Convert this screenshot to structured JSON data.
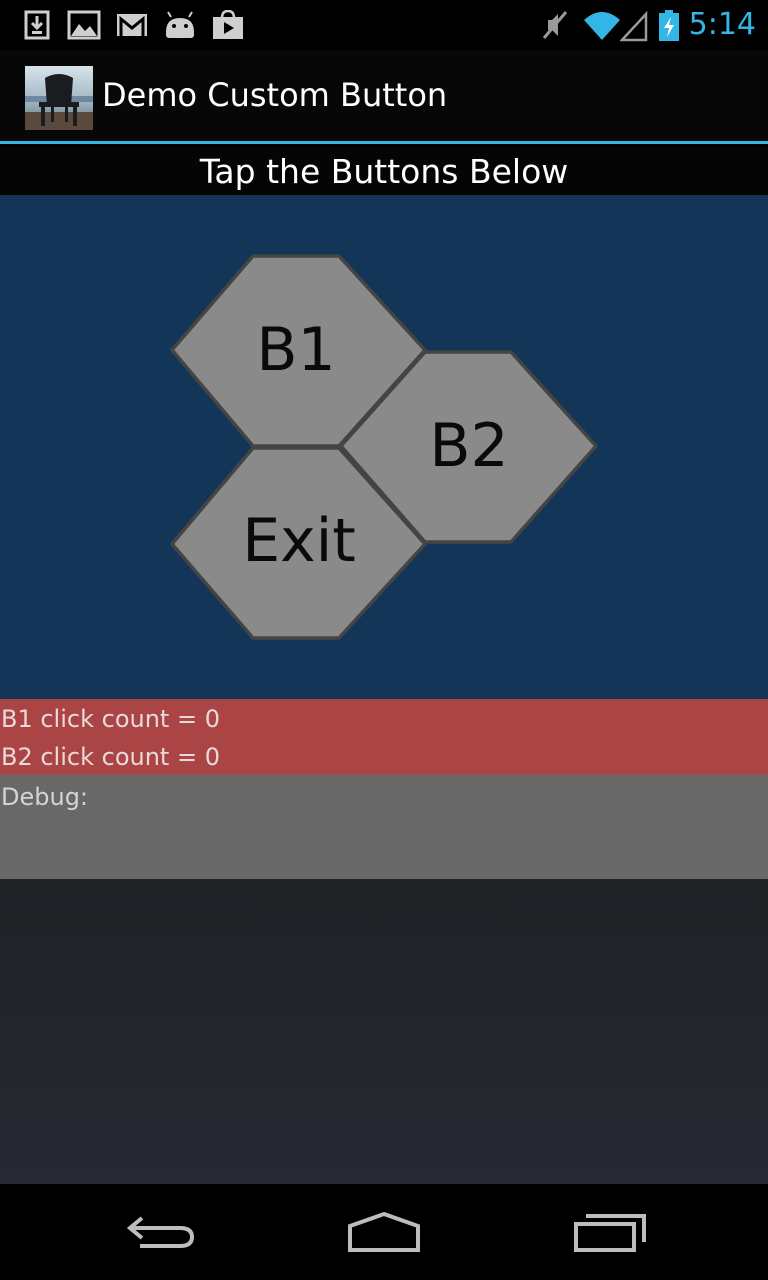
{
  "status_bar": {
    "time": "5:14",
    "accent_color": "#33b5e5",
    "notification_icons": [
      "download-icon",
      "image-icon",
      "gmail-icon",
      "android-icon",
      "play-store-icon"
    ],
    "system_icons": [
      "mute-icon",
      "wifi-icon",
      "signal-icon",
      "battery-charging-icon"
    ]
  },
  "action_bar": {
    "app_icon": "adirondack-chair-photo-icon",
    "title": "Demo Custom Button"
  },
  "header": {
    "text": "Tap the Buttons Below"
  },
  "buttons": {
    "b1_label": "B1",
    "b2_label": "B2",
    "exit_label": "Exit"
  },
  "counts": {
    "b1": "B1 click count = 0",
    "b2": "B2 click count = 0"
  },
  "debug": {
    "label": "Debug:"
  },
  "nav_bar": {
    "icons": [
      "back-icon",
      "home-icon",
      "recent-apps-icon"
    ]
  },
  "colors": {
    "button_area_bg": "#133557",
    "hex_fill": "#8a8a8a",
    "counts_bg": "#ab4444",
    "debug_bg": "#686868"
  }
}
